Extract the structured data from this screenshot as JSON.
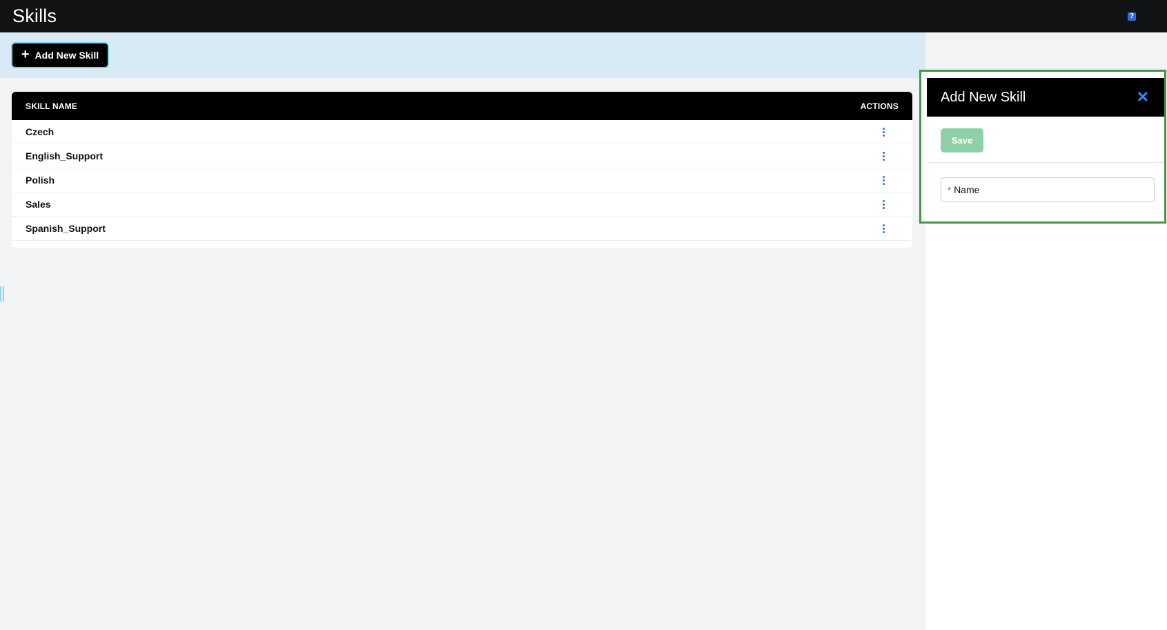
{
  "header": {
    "title": "Skills",
    "help_icon": "?"
  },
  "toolbar": {
    "add_button_label": "Add New Skill",
    "add_icon": "+"
  },
  "table": {
    "columns": [
      "SKILL NAME",
      "ACTIONS"
    ],
    "rows": [
      {
        "name": "Czech"
      },
      {
        "name": "English_Support"
      },
      {
        "name": "Polish"
      },
      {
        "name": "Sales"
      },
      {
        "name": "Spanish_Support"
      }
    ]
  },
  "panel": {
    "title": "Add New Skill",
    "close_icon": "✕",
    "save_label": "Save",
    "name_required_mark": "*",
    "name_label": "Name"
  },
  "colors": {
    "accent": "#2f6fd6",
    "save_disabled": "#8fd0a8",
    "panel_border": "#3f9a3f"
  }
}
